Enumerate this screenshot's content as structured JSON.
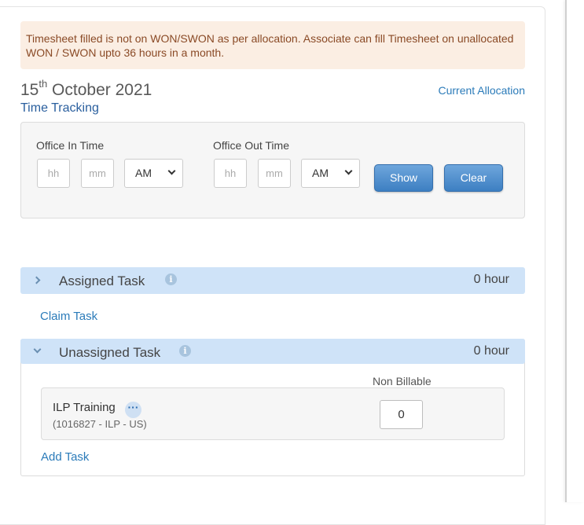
{
  "alert": {
    "text": "Timesheet filled is not on WON/SWON as per allocation. Associate can fill Timesheet on unallocated WON / SWON upto 36 hours in a month."
  },
  "header": {
    "day": "15",
    "day_suffix": "th",
    "month_year": "October 2021",
    "section_title": "Time Tracking",
    "current_allocation_link": "Current Allocation"
  },
  "office_time": {
    "in_label": "Office In Time",
    "out_label": "Office Out Time",
    "in": {
      "hh_placeholder": "hh",
      "mm_placeholder": "mm",
      "ampm": "AM"
    },
    "out": {
      "hh_placeholder": "hh",
      "mm_placeholder": "mm",
      "ampm": "AM"
    },
    "show_button": "Show",
    "clear_button": "Clear"
  },
  "assigned_task": {
    "title": "Assigned Task",
    "hours": "0 hour",
    "claim_link": "Claim Task"
  },
  "unassigned_task": {
    "title": "Unassigned Task",
    "hours": "0 hour",
    "column_header": "Non Billable",
    "tasks": [
      {
        "name": "ILP Training",
        "code": "(1016827 - ILP - US)",
        "non_billable_hours": "0"
      }
    ],
    "add_link": "Add Task"
  },
  "icons": {
    "assigned_caret": "chevron-right-icon",
    "unassigned_caret": "chevron-down-icon",
    "info": "info-icon",
    "more": "more-options-icon",
    "select_arrow": "chevron-down-icon"
  },
  "colors": {
    "alert_bg": "#fbeee3",
    "alert_text": "#8a4a26",
    "task_bar_bg": "#cfe3f8",
    "link": "#2b7bb9",
    "button": "#4a8bcc"
  }
}
